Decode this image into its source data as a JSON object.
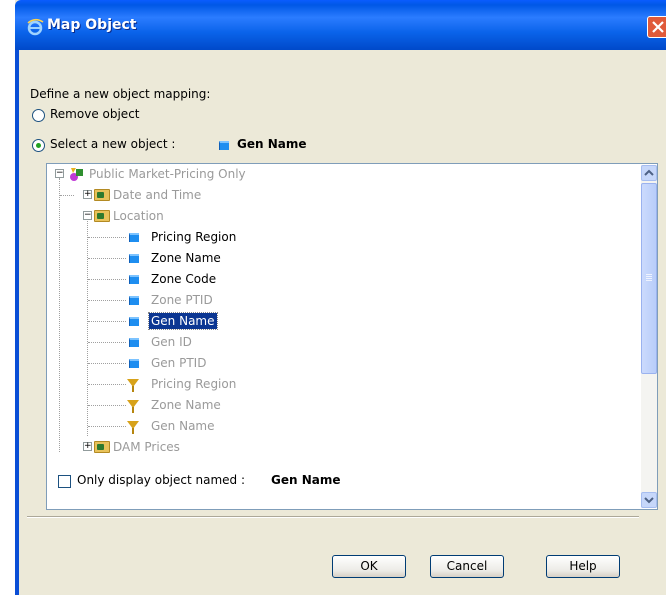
{
  "window": {
    "title": "Map Object",
    "accent": "#0a5cff"
  },
  "dialog": {
    "prompt": "Define a new object mapping:",
    "remove_option": "Remove object",
    "select_option": "Select a new object :",
    "selected_object": "Gen Name",
    "only_display_label": "Only display object named :",
    "only_display_value": "Gen Name"
  },
  "tree": {
    "root": "Public Market-Pricing Only",
    "date_and_time": "Date and Time",
    "location": "Location",
    "items": [
      {
        "label": "Pricing Region",
        "icon": "object-icon",
        "enabled": true
      },
      {
        "label": "Zone Name",
        "icon": "object-icon",
        "enabled": true
      },
      {
        "label": "Zone Code",
        "icon": "object-icon",
        "enabled": true
      },
      {
        "label": "Zone PTID",
        "icon": "object-icon",
        "enabled": false
      },
      {
        "label": "Gen Name",
        "icon": "object-icon",
        "enabled": true,
        "selected": true
      },
      {
        "label": "Gen ID",
        "icon": "object-icon",
        "enabled": false
      },
      {
        "label": "Gen PTID",
        "icon": "object-icon",
        "enabled": false
      },
      {
        "label": "Pricing Region",
        "icon": "filter-icon",
        "enabled": false
      },
      {
        "label": "Zone Name",
        "icon": "filter-icon",
        "enabled": false
      },
      {
        "label": "Gen Name",
        "icon": "filter-icon",
        "enabled": false
      }
    ],
    "dam_prices": "DAM Prices"
  },
  "buttons": {
    "ok": "OK",
    "cancel": "Cancel",
    "help": "Help"
  }
}
